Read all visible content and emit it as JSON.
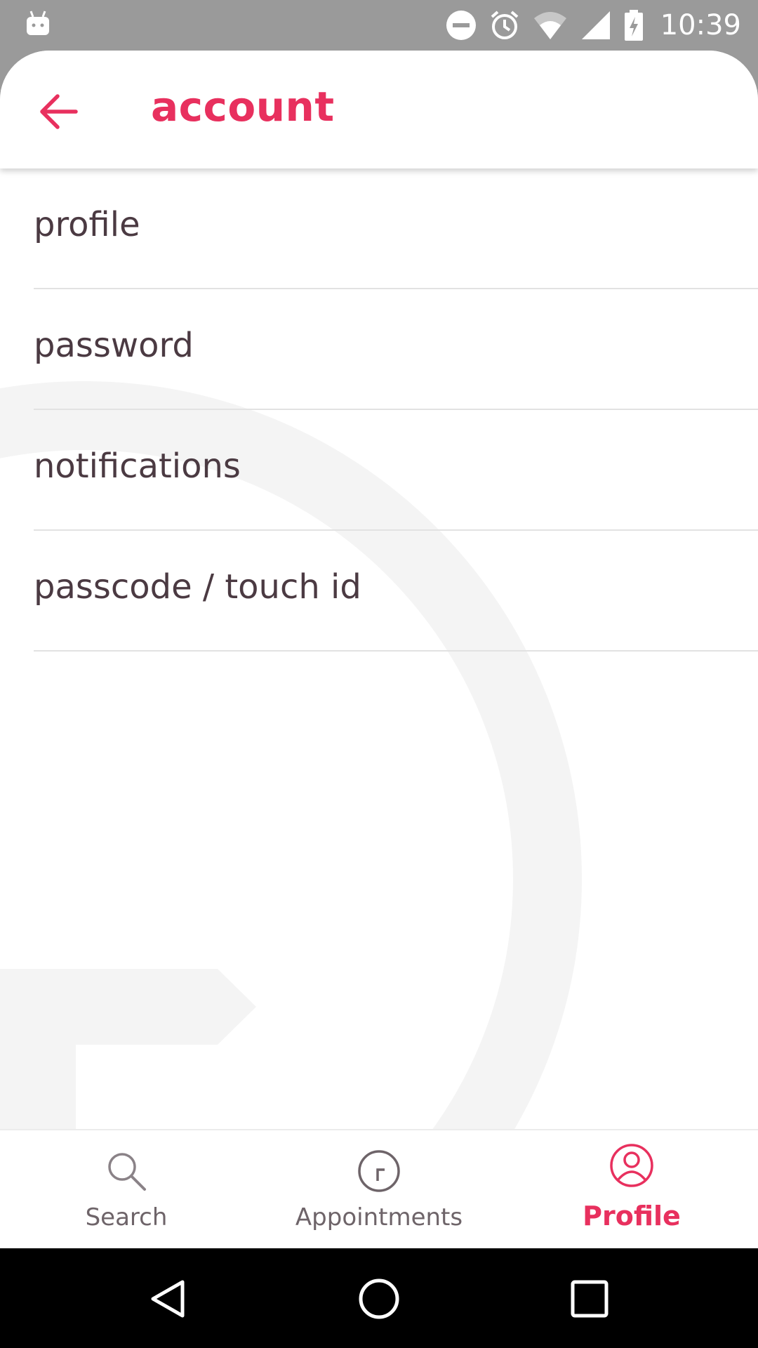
{
  "status_bar": {
    "time": "10:39",
    "icons": [
      "android-icon",
      "do-not-disturb-icon",
      "alarm-icon",
      "wifi-icon",
      "signal-icon",
      "battery-charging-icon"
    ]
  },
  "app_bar": {
    "title": "account",
    "back_icon": "arrow-left-icon"
  },
  "menu": {
    "items": [
      {
        "label": "profile"
      },
      {
        "label": "password"
      },
      {
        "label": "notifications"
      },
      {
        "label": "passcode / touch id"
      }
    ]
  },
  "bottom_nav": {
    "items": [
      {
        "label": "Search",
        "icon": "search-icon",
        "active": false
      },
      {
        "label": "Appointments",
        "icon": "clock-icon",
        "active": false
      },
      {
        "label": "Profile",
        "icon": "user-circle-icon",
        "active": true
      }
    ]
  },
  "system_nav": [
    "back-triangle-icon",
    "home-circle-icon",
    "recents-square-icon"
  ],
  "colors": {
    "accent": "#e8305e",
    "text": "#4b3a42",
    "muted": "#6e6469",
    "divider": "#e2e2e2",
    "status_bar": "#9a9a9a"
  }
}
